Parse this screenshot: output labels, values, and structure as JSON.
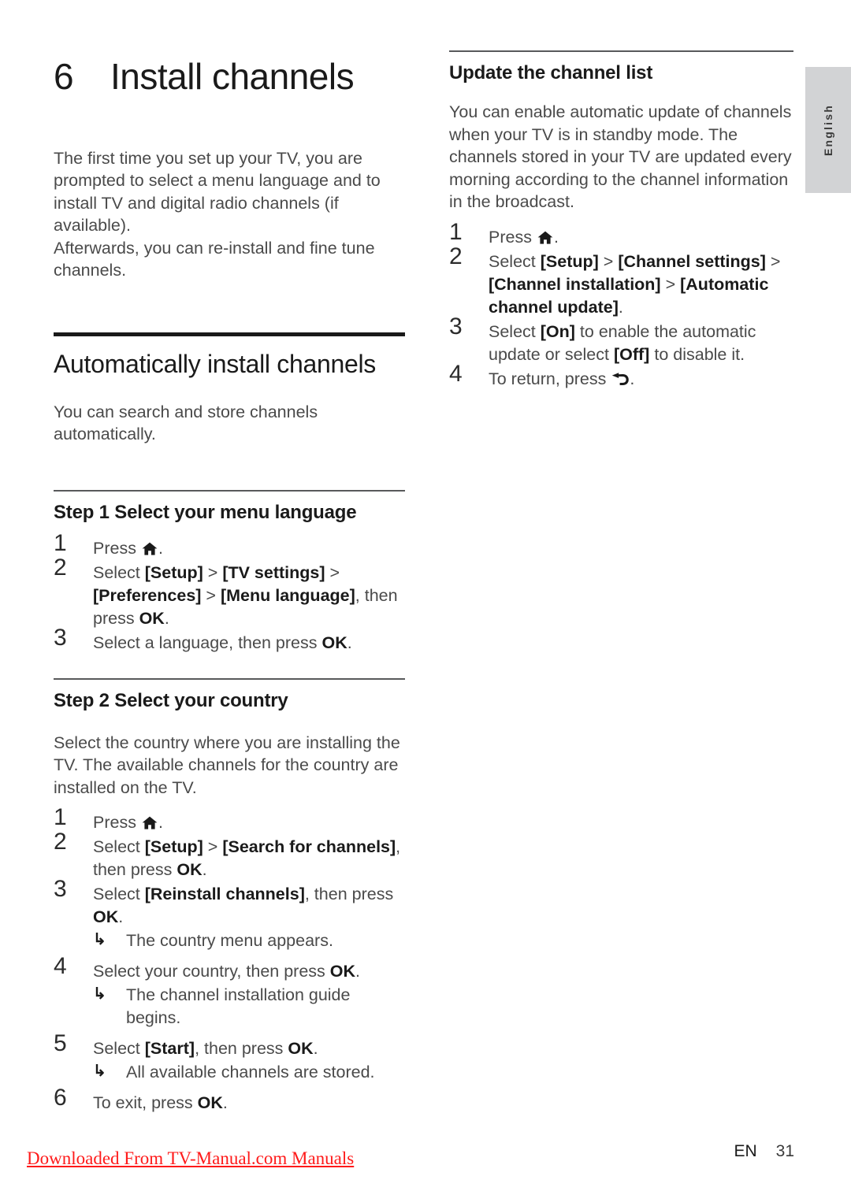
{
  "document": {
    "chapter_number": "6",
    "chapter_title": "Install channels",
    "language_tab": "English"
  },
  "left_column": {
    "intro": "The first time you set up your TV, you are prompted to select a menu language and to install TV and digital radio channels (if available). Afterwards, you can re-install and fine tune channels.",
    "section_title": "Automatically install channels",
    "section_intro": "You can search and store channels automatically.",
    "step1": {
      "heading": "Step 1 Select your menu language",
      "items": [
        {
          "num": "1",
          "text_before": "Press ",
          "icon": "home-icon",
          "text_after": "."
        },
        {
          "num": "2",
          "text": "Select [Setup] > [TV settings] > [Preferences] > [Menu language], then press OK."
        },
        {
          "num": "3",
          "text": "Select a language, then press OK."
        }
      ]
    },
    "step2": {
      "heading": "Step 2 Select your country",
      "intro": "Select the country where you are installing the TV. The available channels for the country are installed on the TV.",
      "items": [
        {
          "num": "1",
          "text_before": "Press ",
          "icon": "home-icon",
          "text_after": "."
        },
        {
          "num": "2",
          "text": "Select [Setup] > [Search for channels], then press OK."
        },
        {
          "num": "3",
          "text": "Select [Reinstall channels], then press OK.",
          "note": "The country menu appears."
        },
        {
          "num": "4",
          "text": "Select your country, then press OK.",
          "note": "The channel installation guide begins."
        },
        {
          "num": "5",
          "text": "Select [Start], then press OK.",
          "note": "All available channels are stored."
        },
        {
          "num": "6",
          "text": "To exit, press OK."
        }
      ]
    }
  },
  "right_column": {
    "heading": "Update the channel list",
    "intro": "You can enable automatic update of channels when your TV is in standby mode. The channels stored in your TV are updated every morning according to the channel information in the broadcast.",
    "items": [
      {
        "num": "1",
        "text_before": "Press ",
        "icon": "home-icon",
        "text_after": "."
      },
      {
        "num": "2",
        "text": "Select [Setup] > [Channel settings] > [Channel installation] > [Automatic channel update]."
      },
      {
        "num": "3",
        "text": "Select [On] to enable the automatic update or select [Off] to disable it."
      },
      {
        "num": "4",
        "text_before": "To return, press ",
        "icon": "back-icon",
        "text_after": "."
      }
    ]
  },
  "footer": {
    "link_text": "Downloaded From TV-Manual.com Manuals",
    "link_color": "#ff1a1a",
    "locale": "EN",
    "page_number": "31"
  },
  "fragments": {
    "l_intro_1": "The first time you set up your TV, you are",
    "l_intro_2": "prompted to select a menu language and to",
    "l_intro_3": "install TV and digital radio channels (if available).",
    "l_intro_4": "Afterwards, you can re-install and fine tune",
    "l_intro_5": "channels.",
    "s1_i1_press": "Press",
    "s1_i2_select": "Select",
    "s1_i2_setup": "[Setup]",
    "s1_i2_gt1": ">",
    "s1_i2_tvsettings": "[TV settings]",
    "s1_i2_gt2": ">",
    "s1_i2_prefs": "[Preferences]",
    "s1_i2_gt3": ">",
    "s1_i2_menulang": "[Menu language]",
    "s1_i2_then": ", then press",
    "s1_i2_ok": "OK",
    "s1_i2_dot": ".",
    "s1_i3_a": "Select a language, then press",
    "s1_i3_ok": "OK",
    "s1_i3_dot": ".",
    "s2_intro_1": "Select the country where you are installing the",
    "s2_intro_2": "TV. The available channels for the country are",
    "s2_intro_3": "installed on the TV.",
    "s2_i2_select": "Select",
    "s2_i2_setup": "[Setup]",
    "s2_i2_gt": ">",
    "s2_i2_search": "[Search for channels]",
    "s2_i2_then": ", then press",
    "s2_i2_ok": "OK",
    "s2_i2_dot": ".",
    "s2_i3_select": "Select",
    "s2_i3_reinstall": "[Reinstall channels]",
    "s2_i3_then": ", then press",
    "s2_i3_ok": "OK",
    "s2_i3_dot": ".",
    "s2_i3_note": "The country menu appears.",
    "s2_i4_a": "Select your country, then press",
    "s2_i4_ok": "OK",
    "s2_i4_dot": ".",
    "s2_i4_note": "The channel installation guide begins.",
    "s2_i5_select": "Select",
    "s2_i5_start": "[Start]",
    "s2_i5_then": ", then press",
    "s2_i5_ok": "OK",
    "s2_i5_dot": ".",
    "s2_i5_note": "All available channels are stored.",
    "s2_i6_a": "To exit, press",
    "s2_i6_ok": "OK",
    "s2_i6_dot": ".",
    "r_intro_1": "You can enable automatic update of channels",
    "r_intro_2": "when your TV is in standby mode. The",
    "r_intro_3": "channels stored in your TV are updated every",
    "r_intro_4": "morning according to the channel information",
    "r_intro_5": "in the broadcast.",
    "r_i2_select": "Select",
    "r_i2_setup": "[Setup]",
    "r_i2_gt1": ">",
    "r_i2_chsettings": "[Channel settings]",
    "r_i2_gt2": ">",
    "r_i2_chinstall": "[Channel installation]",
    "r_i2_gt3": ">",
    "r_i2_autoupd": "[Automatic channel update]",
    "r_i2_dot": ".",
    "r_i3_select": "Select",
    "r_i3_on": "[On]",
    "r_i3_mid": "to enable the automatic update or select",
    "r_i3_off": "[Off]",
    "r_i3_end": "to disable it.",
    "r_i4_a": "To return, press",
    "r_i4_dot": ".",
    "press_word": "Press",
    "dot": "."
  }
}
